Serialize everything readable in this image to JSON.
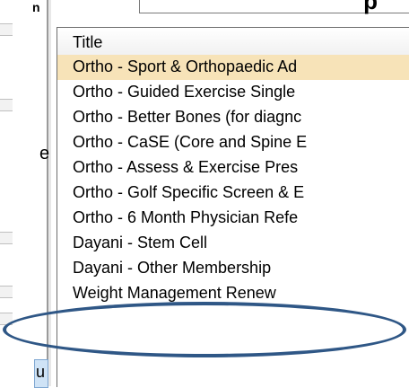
{
  "window_title_fragment": "p",
  "left_panel": {
    "stray_label": "e",
    "tab_letter": "u",
    "top_mark": "n"
  },
  "list": {
    "column_header": "Title",
    "rows": [
      {
        "label": "Ortho - Sport & Orthopaedic Ad",
        "selected": true
      },
      {
        "label": "Ortho - Guided Exercise Single",
        "selected": false
      },
      {
        "label": "Ortho - Better Bones (for diagnc",
        "selected": false
      },
      {
        "label": "Ortho - CaSE (Core and Spine E",
        "selected": false
      },
      {
        "label": "Ortho - Assess & Exercise Pres",
        "selected": false
      },
      {
        "label": "Ortho - Golf Specific Screen & E",
        "selected": false
      },
      {
        "label": "Ortho - 6 Month Physician Refe",
        "selected": false
      },
      {
        "label": "Dayani - Stem Cell",
        "selected": false
      },
      {
        "label": "Dayani - Other Membership",
        "selected": false
      },
      {
        "label": "Weight Management Renew",
        "selected": false
      }
    ]
  },
  "colors": {
    "selected_row": "#f7e3b8",
    "annotation_oval": "#2f5786"
  }
}
